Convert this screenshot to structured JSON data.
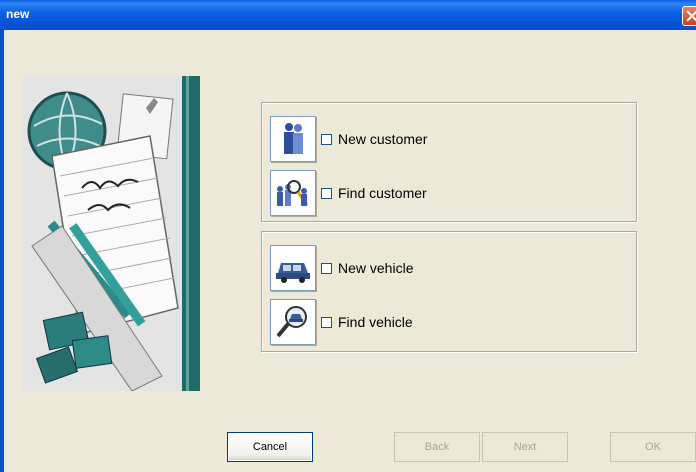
{
  "window": {
    "title": "new"
  },
  "options": [
    {
      "label": "New customer",
      "icon": "customer-icon",
      "checked": false
    },
    {
      "label": "Find customer",
      "icon": "find-customer-icon",
      "checked": false
    },
    {
      "label": "New vehicle",
      "icon": "car-icon",
      "checked": false
    },
    {
      "label": "Find vehicle",
      "icon": "find-vehicle-icon",
      "checked": false
    }
  ],
  "buttons": {
    "cancel": "Cancel",
    "back": "Back",
    "next": "Next",
    "ok": "OK"
  },
  "colors": {
    "titlebar": "#0A5FE0",
    "dialog_bg": "#ECE9D8",
    "teal": "#1F6B6A",
    "group_border": "#ACA899"
  }
}
